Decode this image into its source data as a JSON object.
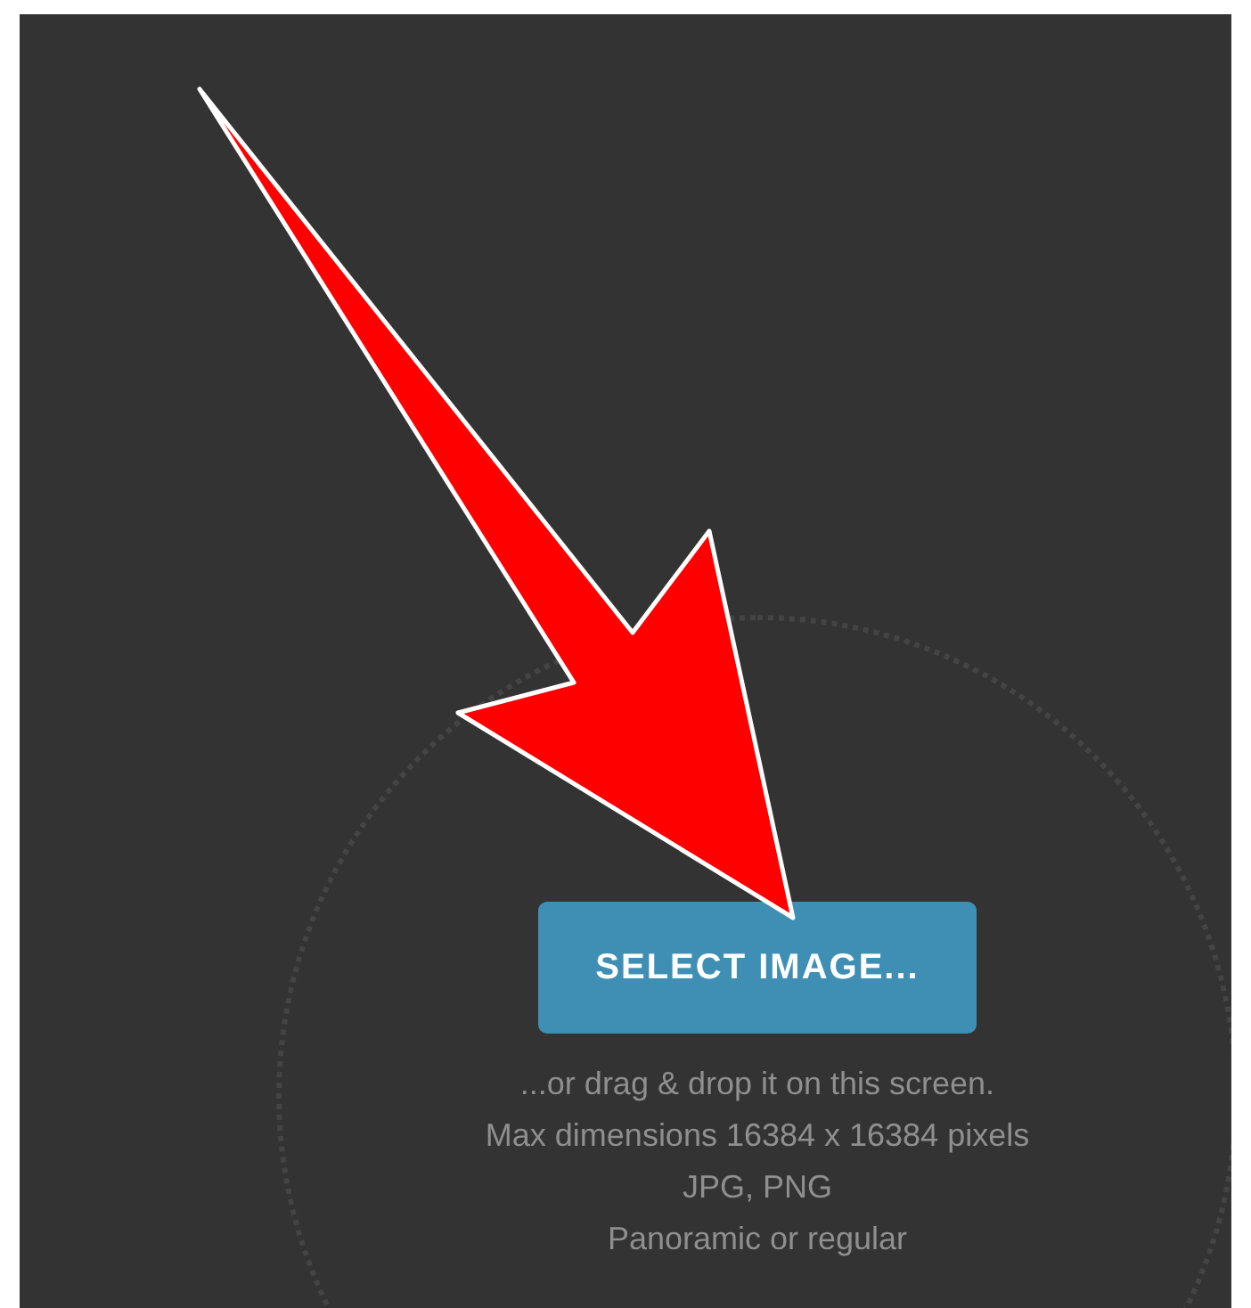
{
  "upload": {
    "button": "SELECT IMAGE...",
    "hints": [
      "...or drag & drop it on this screen.",
      "Max dimensions 16384 x 16384 pixels",
      "JPG, PNG",
      "Panoramic or regular"
    ]
  }
}
